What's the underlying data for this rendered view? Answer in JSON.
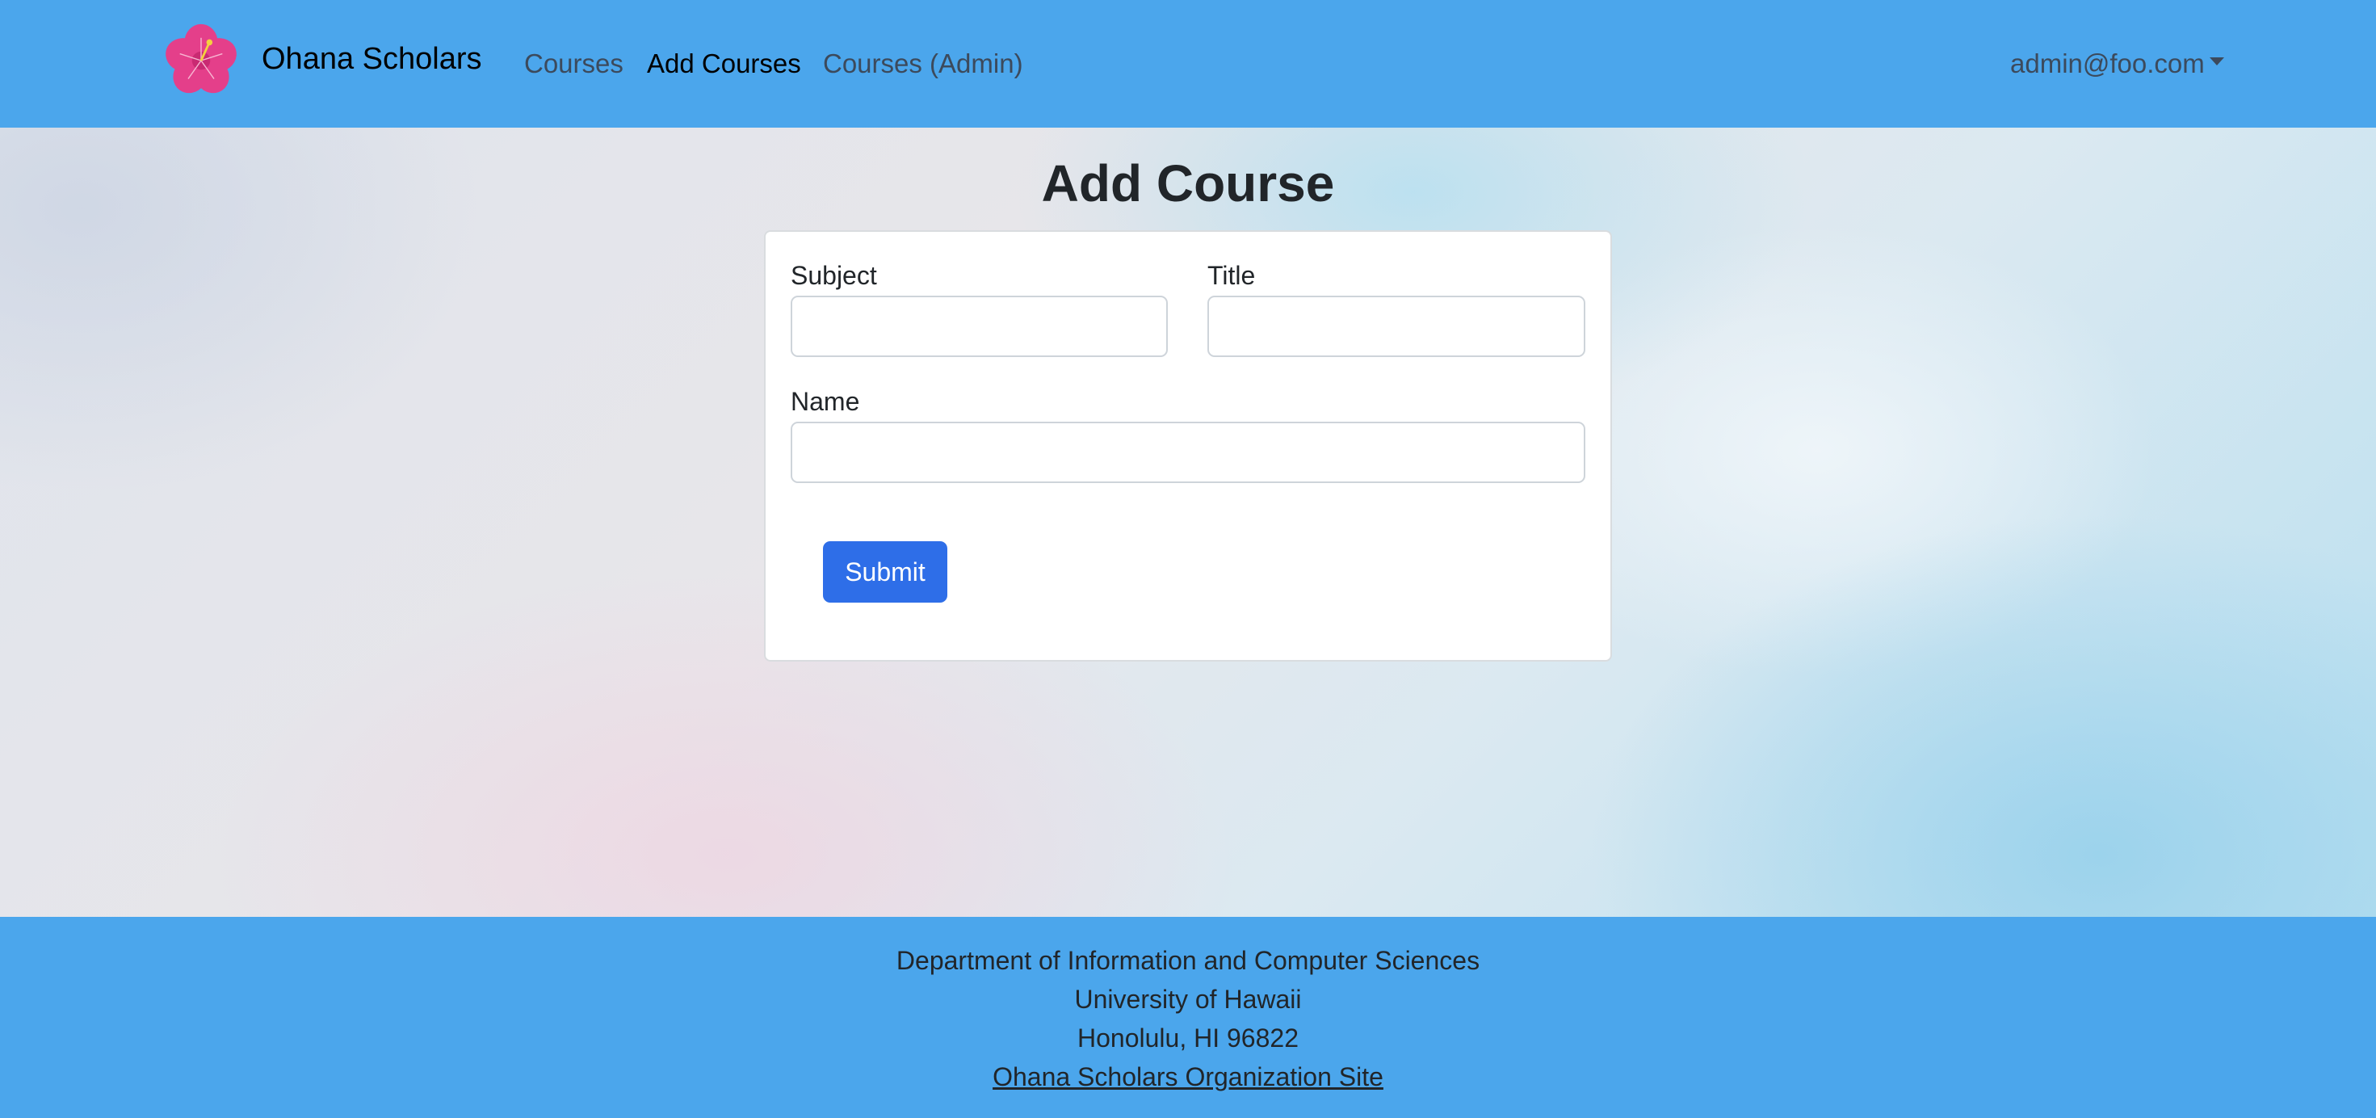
{
  "navbar": {
    "brand": "Ohana Scholars",
    "logo_icon": "hibiscus-flower-icon",
    "links": [
      {
        "label": "Courses",
        "active": false
      },
      {
        "label": "Add Courses",
        "active": true
      },
      {
        "label": "Courses (Admin)",
        "active": false
      }
    ],
    "user": "admin@foo.com",
    "color": "#4ba6ec"
  },
  "main": {
    "title": "Add Course",
    "form": {
      "subject_label": "Subject",
      "subject_value": "",
      "title_label": "Title",
      "title_value": "",
      "name_label": "Name",
      "name_value": "",
      "submit_label": "Submit",
      "submit_color": "#2e6ee8"
    }
  },
  "footer": {
    "line1": "Department of Information and Computer Sciences",
    "line2": "University of Hawaii",
    "line3": "Honolulu, HI 96822",
    "link": "Ohana Scholars Organization Site"
  }
}
